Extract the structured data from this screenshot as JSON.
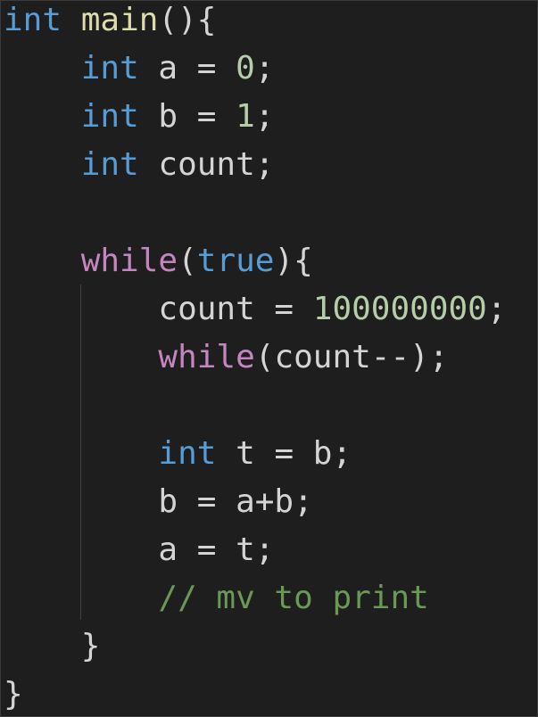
{
  "code_lines": [
    {
      "tokens": [
        {
          "text": "int",
          "type": "kw-type"
        },
        {
          "text": " ",
          "type": "plain"
        },
        {
          "text": "main",
          "type": "fn"
        },
        {
          "text": "(){",
          "type": "plain"
        }
      ]
    },
    {
      "tokens": [
        {
          "text": "    ",
          "type": "plain"
        },
        {
          "text": "int",
          "type": "kw-type"
        },
        {
          "text": " a = ",
          "type": "plain"
        },
        {
          "text": "0",
          "type": "num"
        },
        {
          "text": ";",
          "type": "plain"
        }
      ]
    },
    {
      "tokens": [
        {
          "text": "    ",
          "type": "plain"
        },
        {
          "text": "int",
          "type": "kw-type"
        },
        {
          "text": " b = ",
          "type": "plain"
        },
        {
          "text": "1",
          "type": "num"
        },
        {
          "text": ";",
          "type": "plain"
        }
      ]
    },
    {
      "tokens": [
        {
          "text": "    ",
          "type": "plain"
        },
        {
          "text": "int",
          "type": "kw-type"
        },
        {
          "text": " count;",
          "type": "plain"
        }
      ]
    },
    {
      "tokens": [
        {
          "text": "",
          "type": "plain"
        }
      ]
    },
    {
      "tokens": [
        {
          "text": "    ",
          "type": "plain"
        },
        {
          "text": "while",
          "type": "kw-ctrl"
        },
        {
          "text": "(",
          "type": "plain"
        },
        {
          "text": "true",
          "type": "kw-type"
        },
        {
          "text": "){",
          "type": "plain"
        }
      ]
    },
    {
      "tokens": [
        {
          "text": "        count = ",
          "type": "plain"
        },
        {
          "text": "100000000",
          "type": "num"
        },
        {
          "text": ";",
          "type": "plain"
        }
      ]
    },
    {
      "tokens": [
        {
          "text": "        ",
          "type": "plain"
        },
        {
          "text": "while",
          "type": "kw-ctrl"
        },
        {
          "text": "(count--);",
          "type": "plain"
        }
      ]
    },
    {
      "tokens": [
        {
          "text": "",
          "type": "plain"
        }
      ]
    },
    {
      "tokens": [
        {
          "text": "        ",
          "type": "plain"
        },
        {
          "text": "int",
          "type": "kw-type"
        },
        {
          "text": " t = b;",
          "type": "plain"
        }
      ]
    },
    {
      "tokens": [
        {
          "text": "        b = a+b;",
          "type": "plain"
        }
      ]
    },
    {
      "tokens": [
        {
          "text": "        a = t;",
          "type": "plain"
        }
      ]
    },
    {
      "tokens": [
        {
          "text": "        ",
          "type": "plain"
        },
        {
          "text": "// mv to print",
          "type": "cmt"
        }
      ]
    },
    {
      "tokens": [
        {
          "text": "    }",
          "type": "plain"
        }
      ]
    },
    {
      "tokens": [
        {
          "text": "}",
          "type": "plain"
        }
      ]
    }
  ],
  "theme": {
    "background": "#1e1e1e",
    "type_keyword": "#569cd6",
    "control_keyword": "#c586c0",
    "function_name": "#dcdcaa",
    "number": "#b5cea8",
    "comment": "#6a9955",
    "plain": "#d4d4d4"
  }
}
